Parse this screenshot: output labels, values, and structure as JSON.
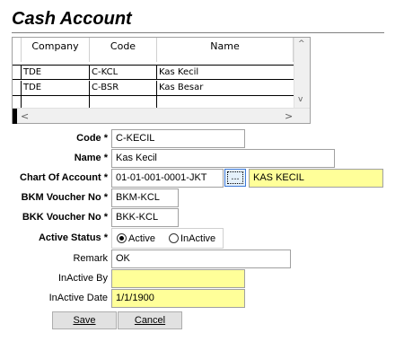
{
  "window": {
    "title": "Cash Account"
  },
  "grid": {
    "columns": [
      "Company",
      "Code",
      "Name"
    ],
    "rows": [
      {
        "company": "TDE",
        "code": "C-KCL",
        "name": "Kas Kecil"
      },
      {
        "company": "TDE",
        "code": "C-BSR",
        "name": "Kas Besar"
      },
      {
        "company": "",
        "code": "",
        "name": ""
      }
    ],
    "scroll_up": "^",
    "scroll_down": "v",
    "scroll_left": "<",
    "scroll_right": ">"
  },
  "form": {
    "code": {
      "label": "Code *",
      "value": "C-KECIL"
    },
    "name": {
      "label": "Name *",
      "value": "Kas Kecil"
    },
    "chart_of_account": {
      "label": "Chart Of Account *",
      "value": "01-01-001-0001-JKT",
      "browse": "...",
      "description": "KAS KECIL"
    },
    "bkm_voucher_no": {
      "label": "BKM Voucher No *",
      "value": "BKM-KCL"
    },
    "bkk_voucher_no": {
      "label": "BKK Voucher No *",
      "value": "BKK-KCL"
    },
    "active_status": {
      "label": "Active Status *",
      "options": [
        "Active",
        "InActive"
      ],
      "selected": "Active"
    },
    "remark": {
      "label": "Remark",
      "value": "OK"
    },
    "inactive_by": {
      "label": "InActive By",
      "value": ""
    },
    "inactive_date": {
      "label": "InActive Date",
      "value": "1/1/1900"
    }
  },
  "buttons": {
    "save": "Save",
    "cancel": "Cancel"
  },
  "colors": {
    "readonly_field": "#ffff99",
    "focus_border": "#3b78d8"
  }
}
